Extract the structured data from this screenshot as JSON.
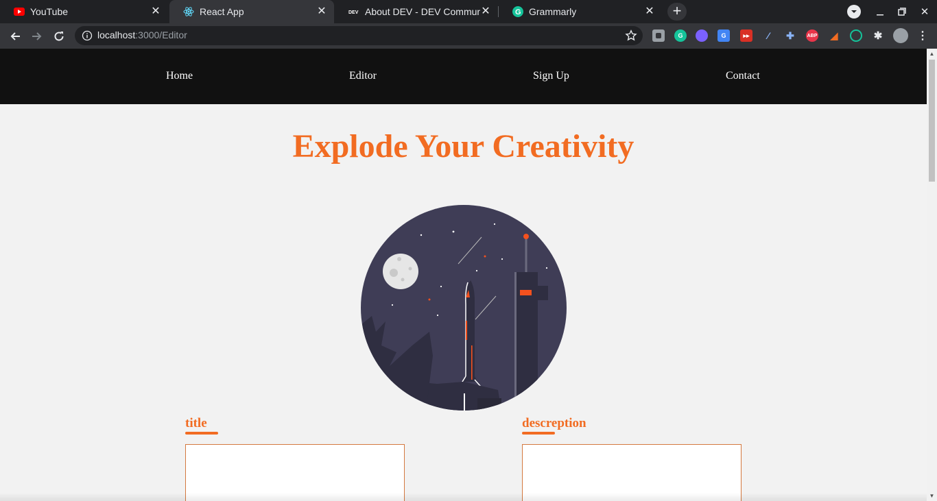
{
  "browser": {
    "tabs": [
      {
        "title": "YouTube",
        "icon": "youtube-icon"
      },
      {
        "title": "React App",
        "icon": "react-icon"
      },
      {
        "title": "About DEV - DEV Community",
        "icon": "dev-icon"
      },
      {
        "title": "Grammarly",
        "icon": "grammarly-icon"
      }
    ],
    "url_host": "localhost",
    "url_path": ":3000/Editor"
  },
  "site": {
    "nav": [
      "Home",
      "Editor",
      "Sign Up",
      "Contact"
    ],
    "headline": "Explode Your Creativity",
    "form": {
      "title_label": "title",
      "description_label": "descreption"
    }
  },
  "colors": {
    "accent": "#f26c22",
    "nav_bg": "#111111",
    "illustration_bg": "#3f3d56"
  }
}
